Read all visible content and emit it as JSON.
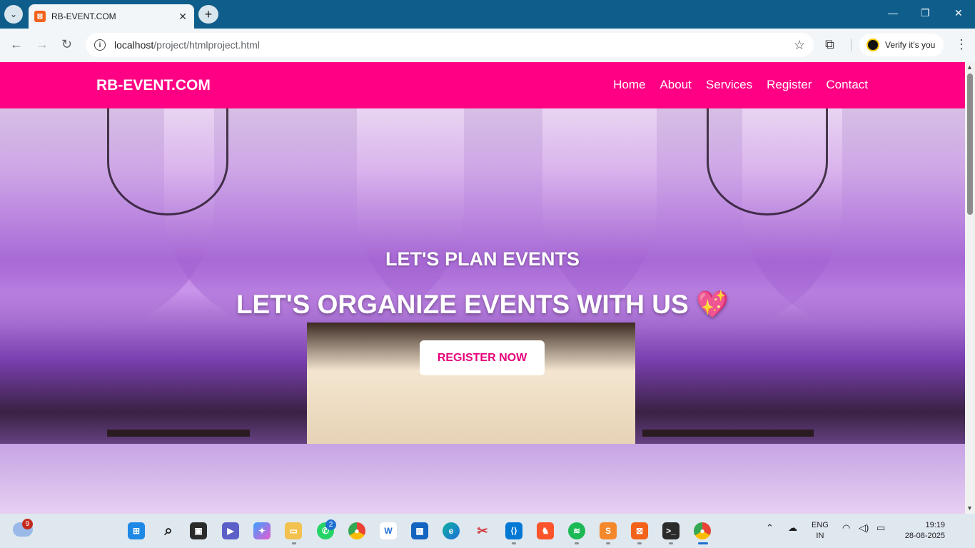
{
  "browser": {
    "tab_title": "RB-EVENT.COM",
    "url_host": "localhost",
    "url_path": "/project/htmlproject.html",
    "profile_label": "Verify it's you"
  },
  "site": {
    "logo": "RB-EVENT.COM",
    "nav": [
      "Home",
      "About",
      "Services",
      "Register",
      "Contact"
    ],
    "hero_subtitle": "LET'S PLAN EVENTS",
    "hero_title": "LET'S ORGANIZE EVENTS WITH US",
    "hero_emoji": "💖",
    "cta_label": "REGISTER NOW",
    "brand_color": "#ff0084"
  },
  "taskbar": {
    "weather_badge": "9",
    "whatsapp_badge": "2",
    "lang_line1": "ENG",
    "lang_line2": "IN",
    "time": "19:19",
    "date": "28-08-2025"
  }
}
